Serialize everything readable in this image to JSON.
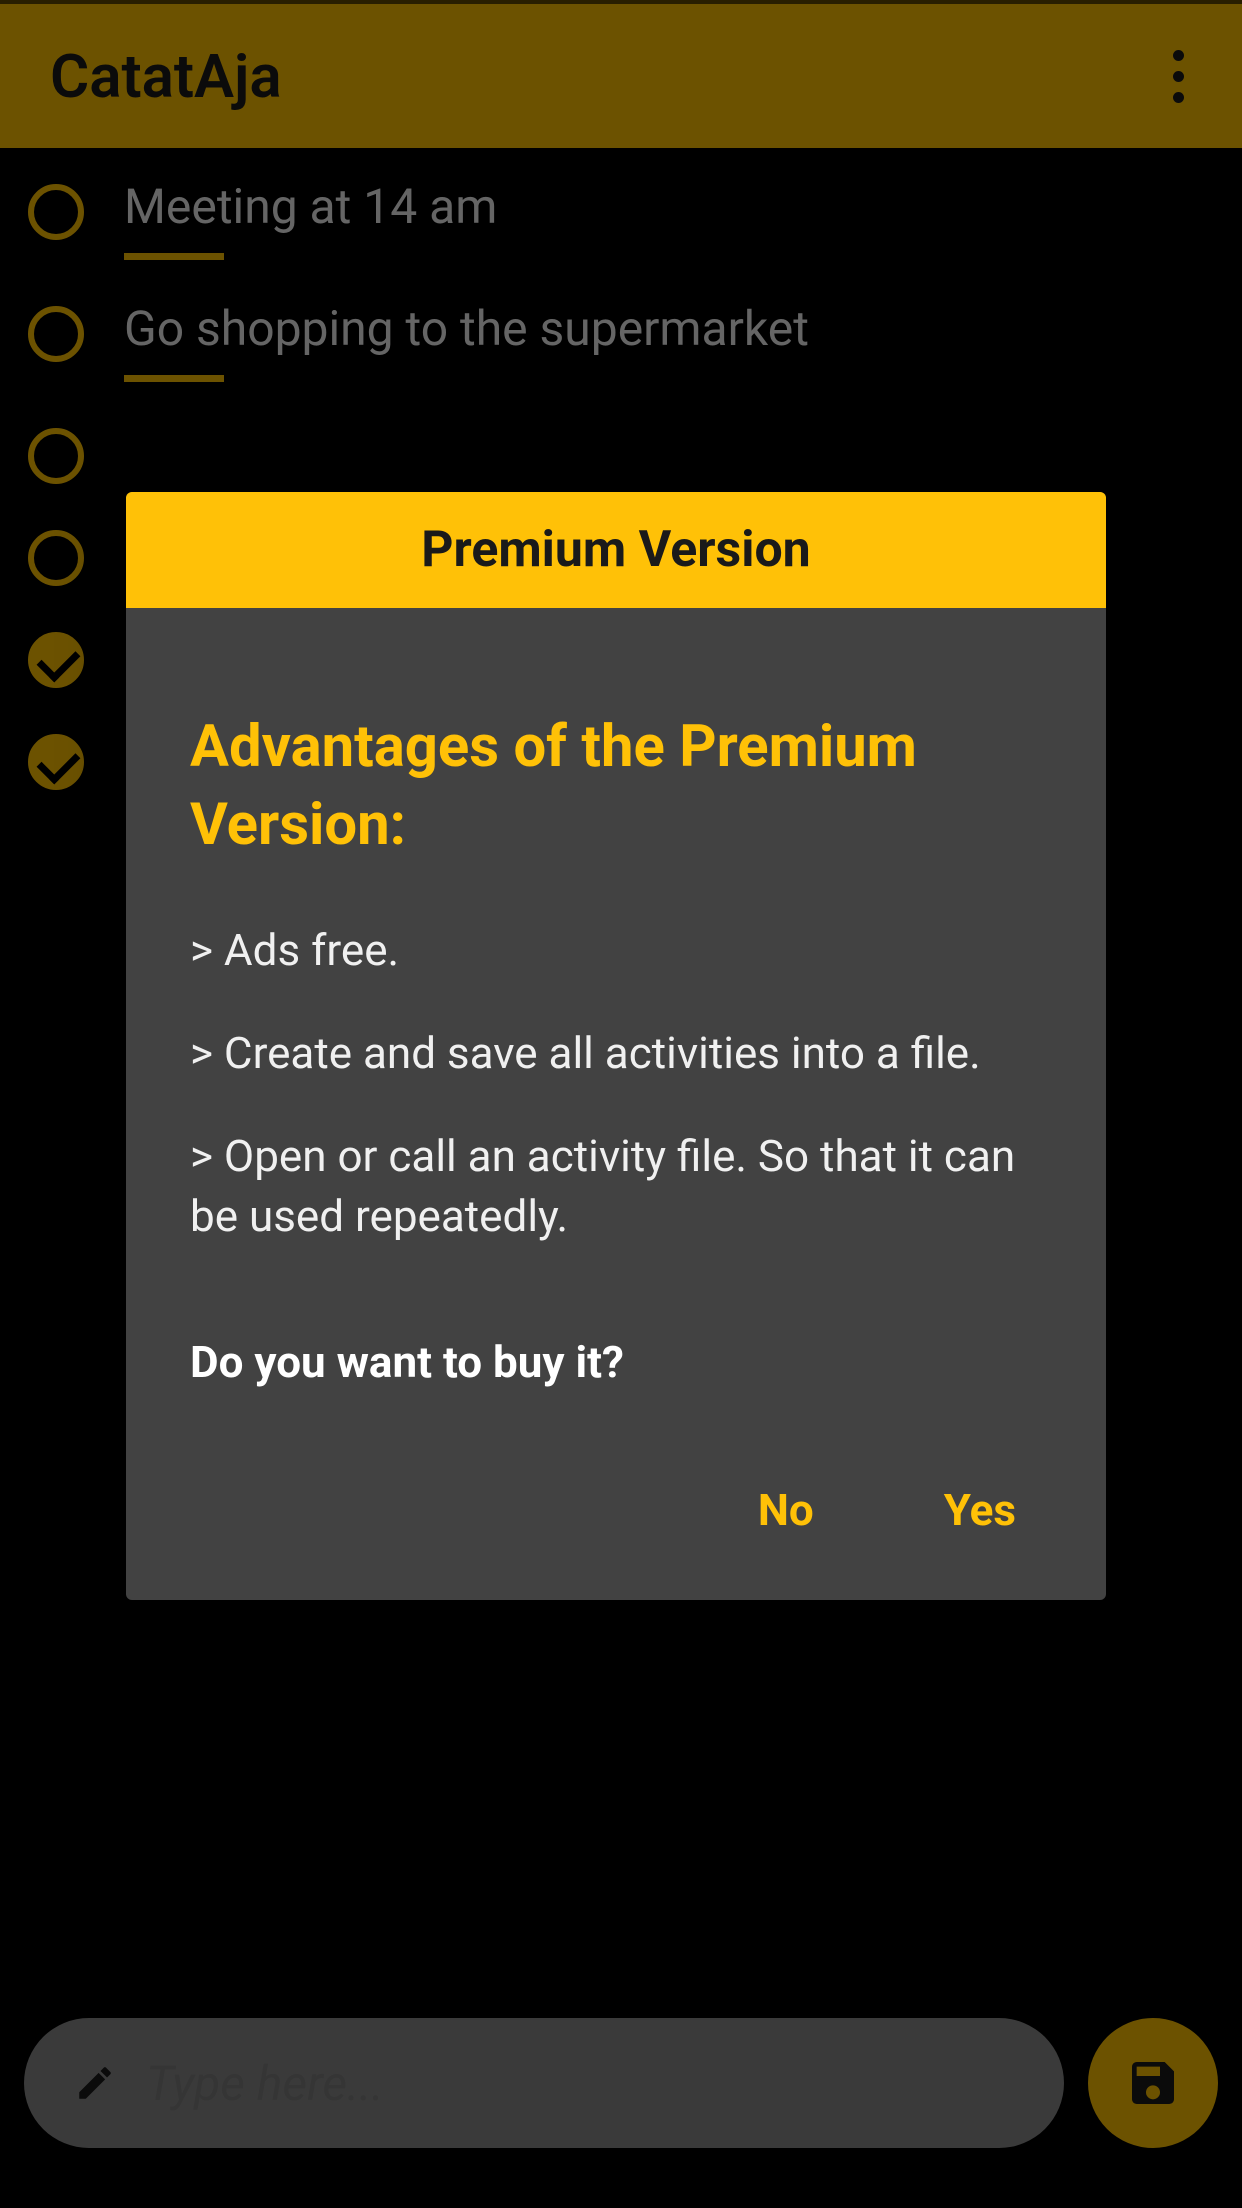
{
  "app": {
    "title": "CatatAja"
  },
  "tasks": [
    {
      "text": "Meeting at 14 am",
      "checked": false,
      "underline": true
    },
    {
      "text": "Go shopping to the supermarket",
      "checked": false,
      "underline": true
    },
    {
      "text": "",
      "checked": false,
      "underline": false
    },
    {
      "text": "",
      "checked": false,
      "underline": false
    },
    {
      "text": "",
      "checked": true,
      "underline": false
    },
    {
      "text": "",
      "checked": true,
      "underline": false
    }
  ],
  "input": {
    "placeholder": "Type here..."
  },
  "dialog": {
    "titlebar": "Premium Version",
    "heading": "Advantages of the Premium Version:",
    "bullets": [
      "> Ads free.",
      "> Create and save all activities into a file.",
      "> Open or call an activity file. So that it can be used repeatedly."
    ],
    "prompt": "Do you want to buy it?",
    "no_label": "No",
    "yes_label": "Yes"
  },
  "icons": {
    "more": "more-vert",
    "pencil": "edit",
    "save": "save"
  }
}
